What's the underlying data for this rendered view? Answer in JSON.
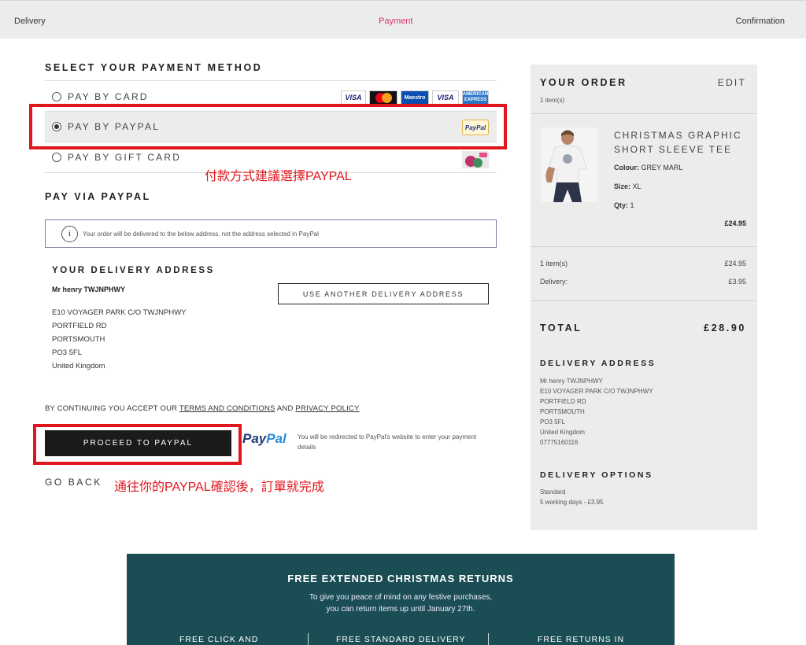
{
  "steps": {
    "delivery": "Delivery",
    "payment": "Payment",
    "confirmation": "Confirmation"
  },
  "payment": {
    "title": "SELECT YOUR PAYMENT METHOD",
    "options": [
      {
        "label": "PAY BY CARD",
        "selected": false
      },
      {
        "label": "PAY BY PAYPAL",
        "selected": true
      },
      {
        "label": "PAY BY GIFT CARD",
        "selected": false
      }
    ],
    "card_logos": [
      "VISA",
      "Maestro",
      "VISA",
      "AMERICAN EXPRESS"
    ],
    "paypal_badge": "PayPal",
    "annotation_choose": "付款方式建議選擇PAYPAL"
  },
  "paypal_section": {
    "title": "PAY VIA PAYPAL",
    "info_icon": "i",
    "info_text": "Your order will be delivered to the below address, not the address selected in PayPal"
  },
  "delivery_address": {
    "title": "YOUR DELIVERY ADDRESS",
    "name": "Mr henry TWJNPHWY",
    "line1": "E10 VOYAGER PARK C/O TWJNPHWY",
    "line2": "PORTFIELD RD",
    "line3": "PORTSMOUTH",
    "line4": "PO3 5FL",
    "line5": "United Kingdom",
    "use_another_label": "USE ANOTHER DELIVERY ADDRESS"
  },
  "terms": {
    "prefix": "BY CONTINUING YOU ACCEPT OUR",
    "terms_link": "TERMS AND CONDITIONS",
    "and": "AND",
    "privacy_link": "PRIVACY POLICY"
  },
  "proceed": {
    "button_label": "PROCEED TO PAYPAL",
    "paypal_pay": "Pay",
    "paypal_pal": "Pal",
    "redirect_text": "You will be redirected to PayPal's website to enter your payment details",
    "go_back": "GO BACK",
    "annotation_confirm": "通往你的PAYPAL確認後，訂單就完成"
  },
  "order": {
    "title": "YOUR ORDER",
    "edit": "EDIT",
    "item_count": "1 item(s)",
    "product": {
      "name": "CHRISTMAS GRAPHIC SHORT SLEEVE TEE",
      "colour_label": "Colour:",
      "colour": "GREY MARL",
      "size_label": "Size:",
      "size": "XL",
      "qty_label": "Qty:",
      "qty": "1",
      "price": "£24.95"
    },
    "subtotal_label": "1 item(s)",
    "subtotal": "£24.95",
    "delivery_label": "Delivery:",
    "delivery": "£3.95",
    "total_label": "TOTAL",
    "total": "£28.90",
    "address_title": "DELIVERY ADDRESS",
    "address": {
      "name": "Mr henry TWJNPHWY",
      "line1": "E10 VOYAGER PARK C/O TWJNPHWY",
      "line2": "PORTFIELD RD",
      "line3": "PORTSMOUTH",
      "line4": "PO3 5FL",
      "line5": "United Kingdom",
      "phone": "07775160116"
    },
    "options_title": "DELIVERY OPTIONS",
    "option_name": "Standard",
    "option_detail": "5 working days - £3.95"
  },
  "banner": {
    "title": "FREE EXTENDED CHRISTMAS RETURNS",
    "sub1": "To give you peace of mind on any festive purchases,",
    "sub2": "you can return items up until January 27th.",
    "col1": "FREE CLICK AND",
    "col2": "FREE STANDARD DELIVERY",
    "col3": "FREE RETURNS IN"
  },
  "colors": {
    "accent_pink": "#d6336c",
    "annotation_red": "#e0161d",
    "banner_teal": "#1b4d55"
  }
}
